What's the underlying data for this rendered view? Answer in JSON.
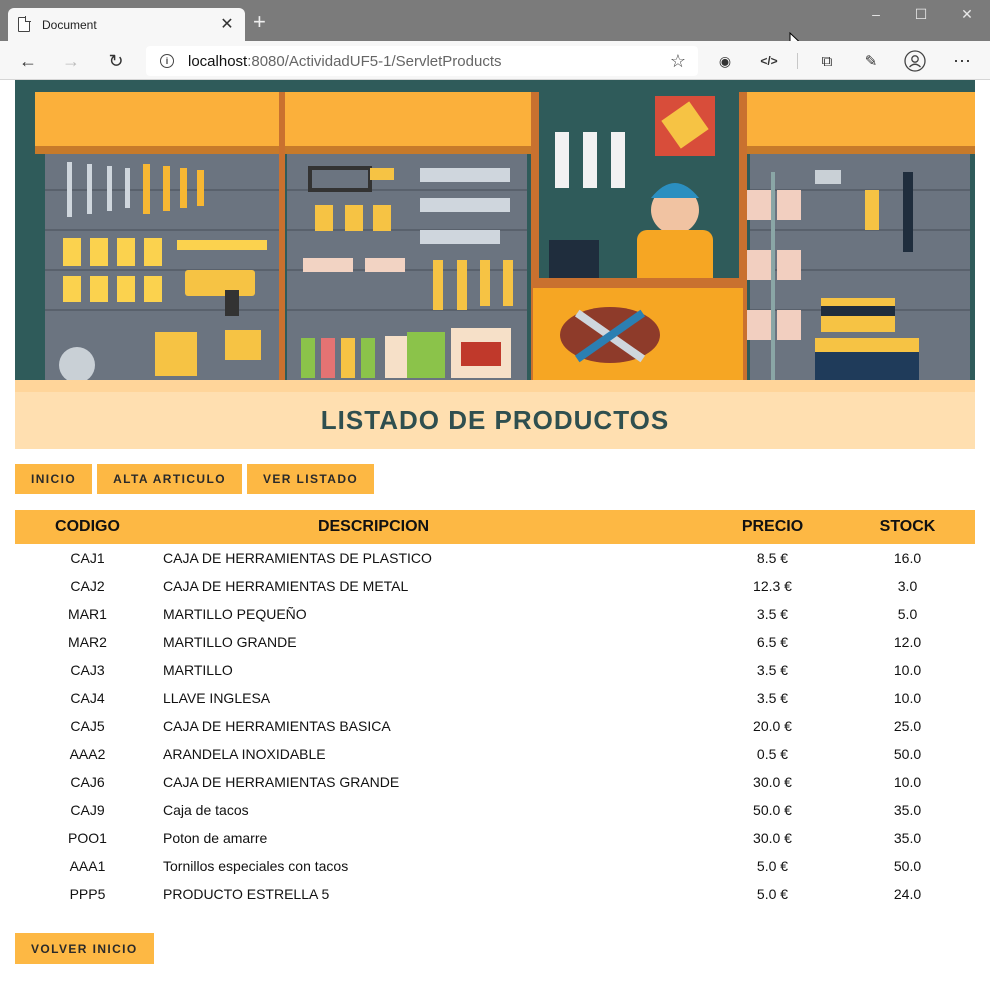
{
  "browser": {
    "tab_title": "Document",
    "tab_close": "✕",
    "new_tab": "+",
    "url_host": "localhost",
    "url_rest": ":8080/ActividadUF5-1/ServletProducts"
  },
  "page": {
    "title": "LISTADO DE PRODUCTOS",
    "nav": [
      "INICIO",
      "ALTA ARTICULO",
      "VER LISTADO"
    ],
    "back_button": "VOLVER INICIO"
  },
  "table": {
    "headers": [
      "CODIGO",
      "DESCRIPCION",
      "PRECIO",
      "STOCK"
    ],
    "rows": [
      [
        "CAJ1",
        "CAJA DE HERRAMIENTAS DE PLASTICO",
        "8.5 €",
        "16.0"
      ],
      [
        "CAJ2",
        "CAJA DE HERRAMIENTAS DE METAL",
        "12.3 €",
        "3.0"
      ],
      [
        "MAR1",
        "MARTILLO PEQUEÑO",
        "3.5 €",
        "5.0"
      ],
      [
        "MAR2",
        "MARTILLO GRANDE",
        "6.5 €",
        "12.0"
      ],
      [
        "CAJ3",
        "MARTILLO",
        "3.5 €",
        "10.0"
      ],
      [
        "CAJ4",
        "LLAVE INGLESA",
        "3.5 €",
        "10.0"
      ],
      [
        "CAJ5",
        "CAJA DE HERRAMIENTAS BASICA",
        "20.0 €",
        "25.0"
      ],
      [
        "AAA2",
        "ARANDELA INOXIDABLE",
        "0.5 €",
        "50.0"
      ],
      [
        "CAJ6",
        "CAJA DE HERRAMIENTAS GRANDE",
        "30.0 €",
        "10.0"
      ],
      [
        "CAJ9",
        "Caja de tacos",
        "50.0 €",
        "35.0"
      ],
      [
        "POO1",
        "Poton de amarre",
        "30.0 €",
        "35.0"
      ],
      [
        "AAA1",
        "Tornillos especiales con tacos",
        "5.0 €",
        "50.0"
      ],
      [
        "PPP5",
        "PRODUCTO ESTRELLA 5",
        "5.0 €",
        "24.0"
      ]
    ]
  },
  "colors": {
    "accent": "#fdb844",
    "title_band": "#ffdfb0",
    "title_text": "#2f4f4f",
    "browser_titlebar": "#7b7b7b"
  }
}
